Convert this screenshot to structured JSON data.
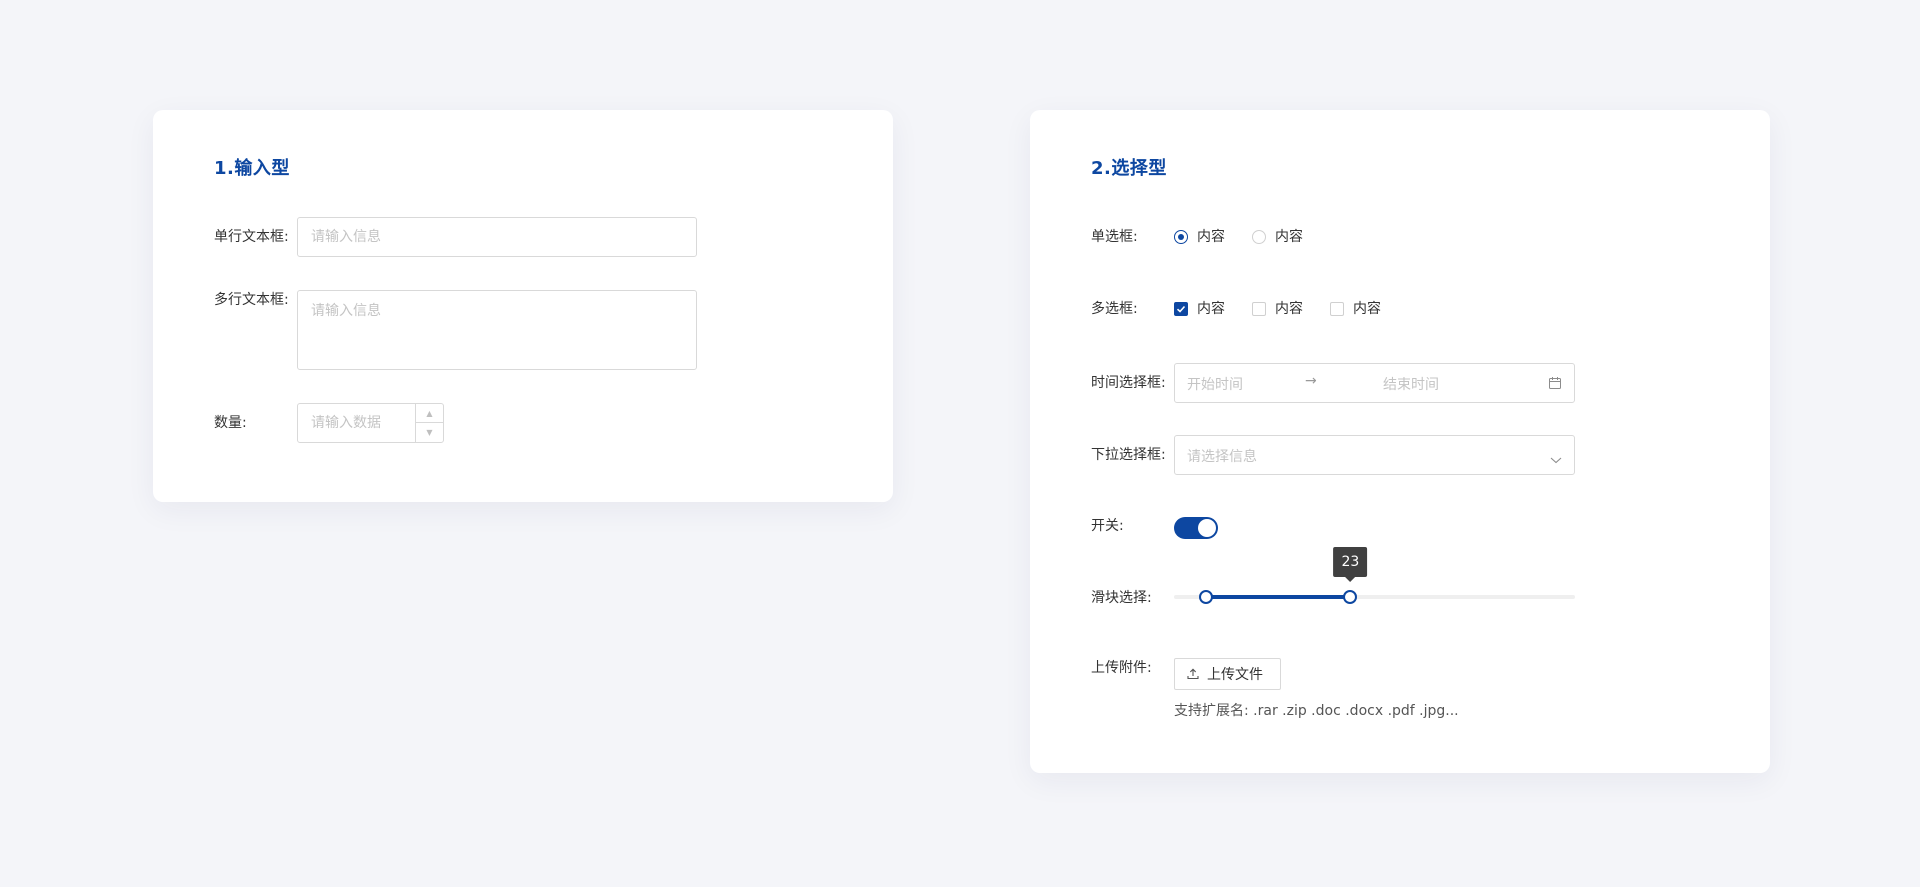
{
  "input_card": {
    "title": "1.输入型",
    "single_line": {
      "label": "单行文本框:",
      "placeholder": "请输入信息",
      "value": ""
    },
    "multi_line": {
      "label": "多行文本框:",
      "placeholder": "请输入信息",
      "value": ""
    },
    "quantity": {
      "label": "数量:",
      "placeholder": "请输入数据",
      "value": ""
    }
  },
  "select_card": {
    "title": "2.选择型",
    "radio": {
      "label": "单选框:",
      "options": [
        {
          "label": "内容",
          "checked": true
        },
        {
          "label": "内容",
          "checked": false
        }
      ]
    },
    "checkbox": {
      "label": "多选框:",
      "options": [
        {
          "label": "内容",
          "checked": true
        },
        {
          "label": "内容",
          "checked": false
        },
        {
          "label": "内容",
          "checked": false
        }
      ]
    },
    "date_range": {
      "label": "时间选择框:",
      "start_placeholder": "开始时间",
      "separator": "→",
      "end_placeholder": "结束时间",
      "icon": "calendar-icon"
    },
    "dropdown": {
      "label": "下拉选择框:",
      "placeholder": "请选择信息",
      "icon": "chevron-down-icon"
    },
    "switch": {
      "label": "开关:",
      "on": true
    },
    "slider": {
      "label": "滑块选择:",
      "min": 0,
      "max": 100,
      "low": 8,
      "high": 44,
      "tooltip": "23"
    },
    "upload": {
      "label": "上传附件:",
      "button_label": "上传文件",
      "icon": "upload-icon",
      "hint": "支持扩展名: .rar .zip .doc .docx .pdf .jpg..."
    },
    "accent_color": "#0d47a1"
  }
}
